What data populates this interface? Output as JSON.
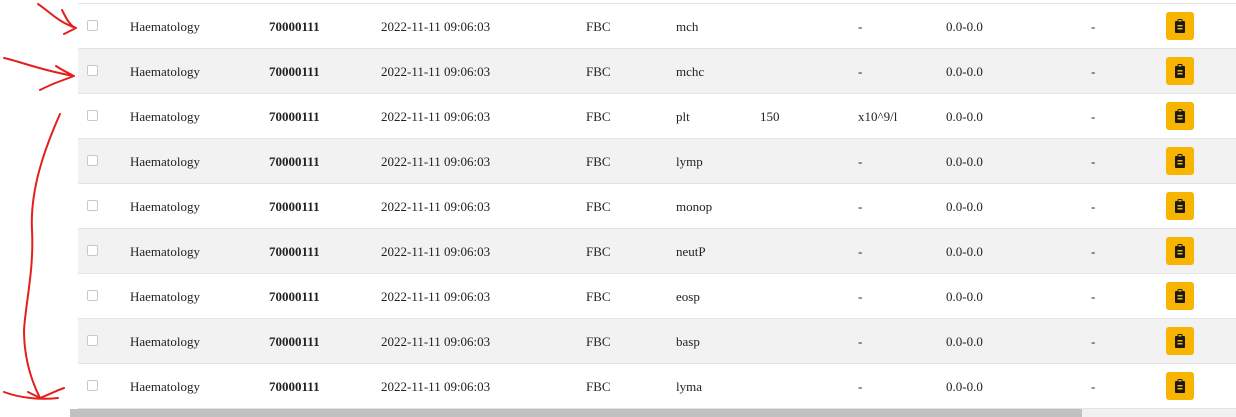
{
  "rows": [
    {
      "dept": "Haematology",
      "id": "70000111",
      "date": "2022-11-11 09:06:03",
      "panel": "FBC",
      "test": "mch",
      "value": "",
      "unit": "-",
      "range": "0.0-0.0",
      "flag": "-"
    },
    {
      "dept": "Haematology",
      "id": "70000111",
      "date": "2022-11-11 09:06:03",
      "panel": "FBC",
      "test": "mchc",
      "value": "",
      "unit": "-",
      "range": "0.0-0.0",
      "flag": "-"
    },
    {
      "dept": "Haematology",
      "id": "70000111",
      "date": "2022-11-11 09:06:03",
      "panel": "FBC",
      "test": "plt",
      "value": "150",
      "unit": "x10^9/l",
      "range": "0.0-0.0",
      "flag": "-"
    },
    {
      "dept": "Haematology",
      "id": "70000111",
      "date": "2022-11-11 09:06:03",
      "panel": "FBC",
      "test": "lymp",
      "value": "",
      "unit": "-",
      "range": "0.0-0.0",
      "flag": "-"
    },
    {
      "dept": "Haematology",
      "id": "70000111",
      "date": "2022-11-11 09:06:03",
      "panel": "FBC",
      "test": "monop",
      "value": "",
      "unit": "-",
      "range": "0.0-0.0",
      "flag": "-"
    },
    {
      "dept": "Haematology",
      "id": "70000111",
      "date": "2022-11-11 09:06:03",
      "panel": "FBC",
      "test": "neutP",
      "value": "",
      "unit": "-",
      "range": "0.0-0.0",
      "flag": "-"
    },
    {
      "dept": "Haematology",
      "id": "70000111",
      "date": "2022-11-11 09:06:03",
      "panel": "FBC",
      "test": "eosp",
      "value": "",
      "unit": "-",
      "range": "0.0-0.0",
      "flag": "-"
    },
    {
      "dept": "Haematology",
      "id": "70000111",
      "date": "2022-11-11 09:06:03",
      "panel": "FBC",
      "test": "basp",
      "value": "",
      "unit": "-",
      "range": "0.0-0.0",
      "flag": "-"
    },
    {
      "dept": "Haematology",
      "id": "70000111",
      "date": "2022-11-11 09:06:03",
      "panel": "FBC",
      "test": "lyma",
      "value": "",
      "unit": "-",
      "range": "0.0-0.0",
      "flag": "-"
    }
  ],
  "actions": {
    "icon": "clipboard-icon"
  },
  "colors": {
    "action_button": "#f7b500",
    "row_alt": "#f2f2f2",
    "annotation": "#e3201b"
  }
}
